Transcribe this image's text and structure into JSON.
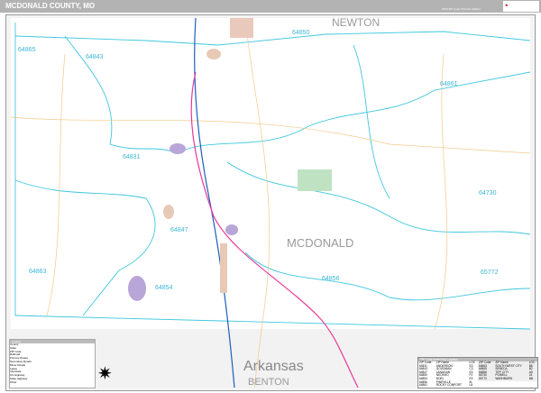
{
  "header": {
    "title": "MCDONALD COUNTY, MO",
    "edition": "2020 ZIP Code Premium Edition",
    "logo": "MARKET MAPS"
  },
  "map": {
    "county_labels": [
      "NEWTON",
      "MCDONALD",
      "BENTON"
    ],
    "state_label": "Arkansas",
    "zip_labels": [
      "64865",
      "64843",
      "64850",
      "64861",
      "64831",
      "64847",
      "64730",
      "64863",
      "64854",
      "64856",
      "65772"
    ],
    "colors": {
      "zip_boundary": "#3ec7de",
      "interstate": "#1d5fb8",
      "highway": "#e83a9a",
      "road": "#f3c98a",
      "city": "#b9a6d8",
      "frame": "#b3b3b3"
    }
  },
  "legend": {
    "title": "Legend",
    "items": [
      "County",
      "State",
      "ZIP Code",
      "Railroad",
      "Primary Roads",
      "Secondary Roads",
      "Minor Roads",
      "Lakes",
      "Interstate",
      "US Highway",
      "State Highway",
      "Other"
    ]
  },
  "index": {
    "title": "ZIP Code Index/Grid Location",
    "headers": [
      "ZIP Code",
      "ZIP Name",
      "LOC"
    ],
    "left": [
      [
        "64831",
        "ANDERSON",
        "E3"
      ],
      [
        "64843",
        "GOODMAN",
        "C3"
      ],
      [
        "64847",
        "LANAGAN",
        "E3"
      ],
      [
        "64850",
        "NEOSHO",
        "F2"
      ],
      [
        "64854",
        "NOEL",
        "E3"
      ],
      [
        "64856",
        "PINEVILLE",
        "I6"
      ],
      [
        "64861",
        "ROCKY COMFORT",
        "L8"
      ]
    ],
    "right": [
      [
        "64863",
        "SOUTH WEST CITY",
        "B6"
      ],
      [
        "64865",
        "SENECA",
        "B2"
      ],
      [
        "64866",
        "TIFF CITY",
        "A5"
      ],
      [
        "65730",
        "POWELL",
        "L5"
      ],
      [
        "65772",
        "WASHBURN",
        "M6"
      ]
    ]
  }
}
